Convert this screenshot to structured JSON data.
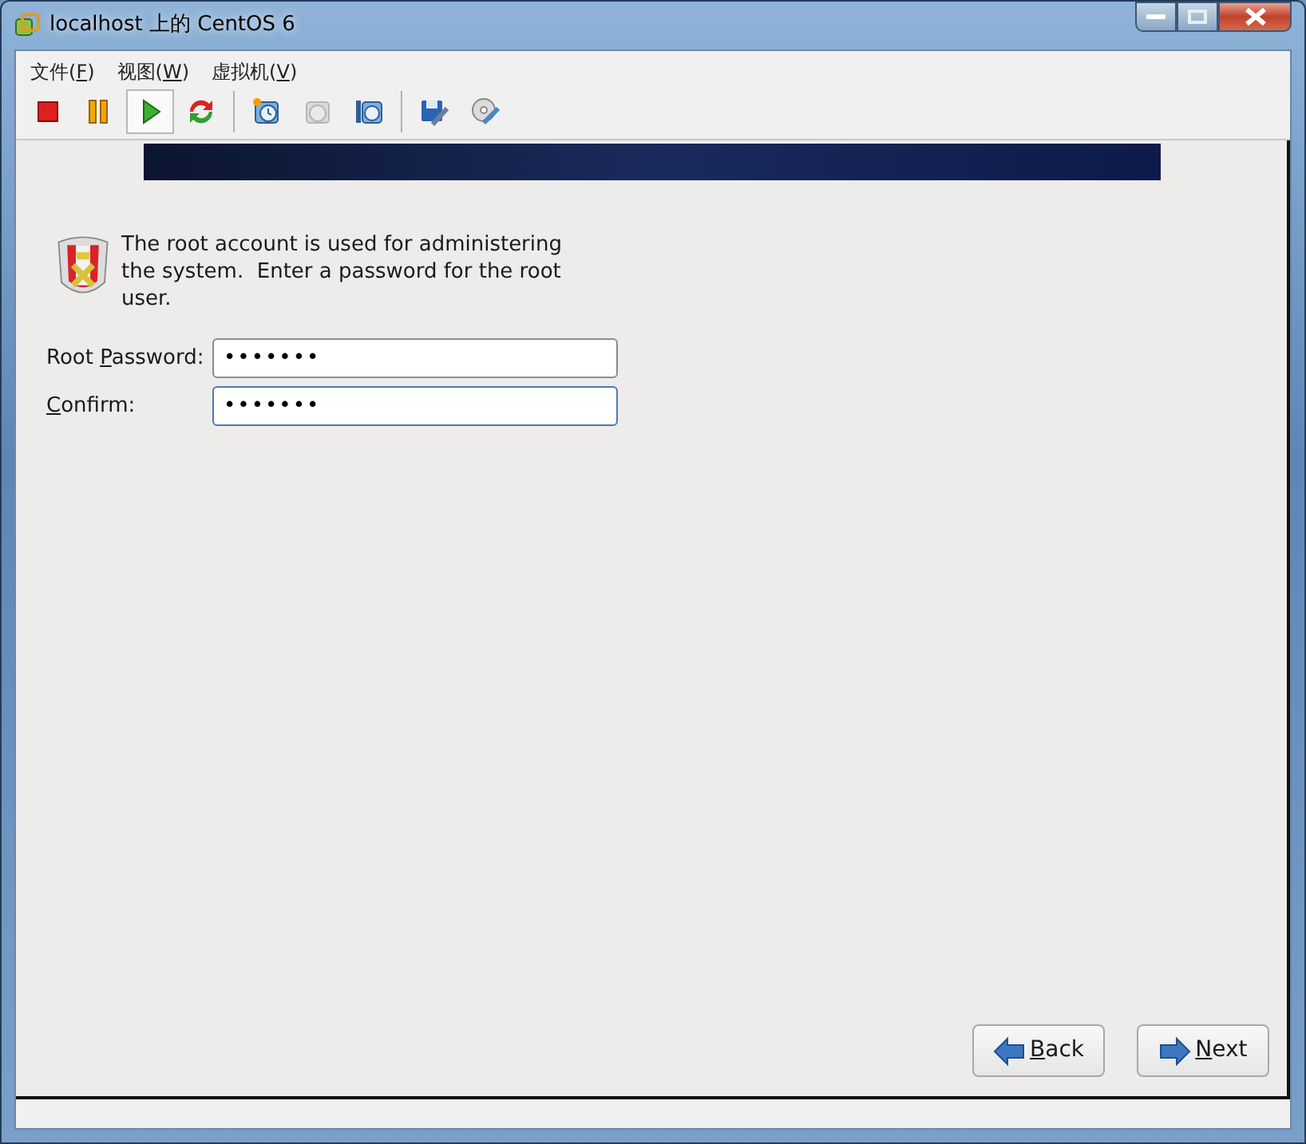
{
  "window": {
    "title": "localhost 上的 CentOS 6"
  },
  "menu": [
    {
      "pre": "文件(",
      "key": "F",
      "post": ")"
    },
    {
      "pre": "视图(",
      "key": "W",
      "post": ")"
    },
    {
      "pre": "虚拟机(",
      "key": "V",
      "post": ")"
    }
  ],
  "toolbar": [
    {
      "kind": "stop",
      "selected": false,
      "disabled": false
    },
    {
      "kind": "pause",
      "selected": false,
      "disabled": false
    },
    {
      "kind": "play",
      "selected": true,
      "disabled": false
    },
    {
      "kind": "reset",
      "selected": false,
      "disabled": false
    },
    {
      "kind": "sep"
    },
    {
      "kind": "snapshot",
      "selected": false,
      "disabled": false
    },
    {
      "kind": "revert",
      "selected": false,
      "disabled": true
    },
    {
      "kind": "manager",
      "selected": false,
      "disabled": false
    },
    {
      "kind": "sep"
    },
    {
      "kind": "settings",
      "selected": false,
      "disabled": false
    },
    {
      "kind": "media",
      "selected": false,
      "disabled": false
    }
  ],
  "installer": {
    "intro": "The root account is used for administering the system.  Enter a password for the root user.",
    "fields": [
      {
        "label": {
          "pre": "Root ",
          "key": "P",
          "post": "assword:"
        },
        "value": "•••••••",
        "focused": false
      },
      {
        "label": {
          "key": "C",
          "post": "onfirm:"
        },
        "value": "•••••••",
        "focused": true
      }
    ],
    "buttons": [
      {
        "kind": "back",
        "label": {
          "key": "B",
          "post": "ack"
        }
      },
      {
        "kind": "next",
        "label": {
          "key": "N",
          "post": "ext"
        }
      }
    ]
  }
}
